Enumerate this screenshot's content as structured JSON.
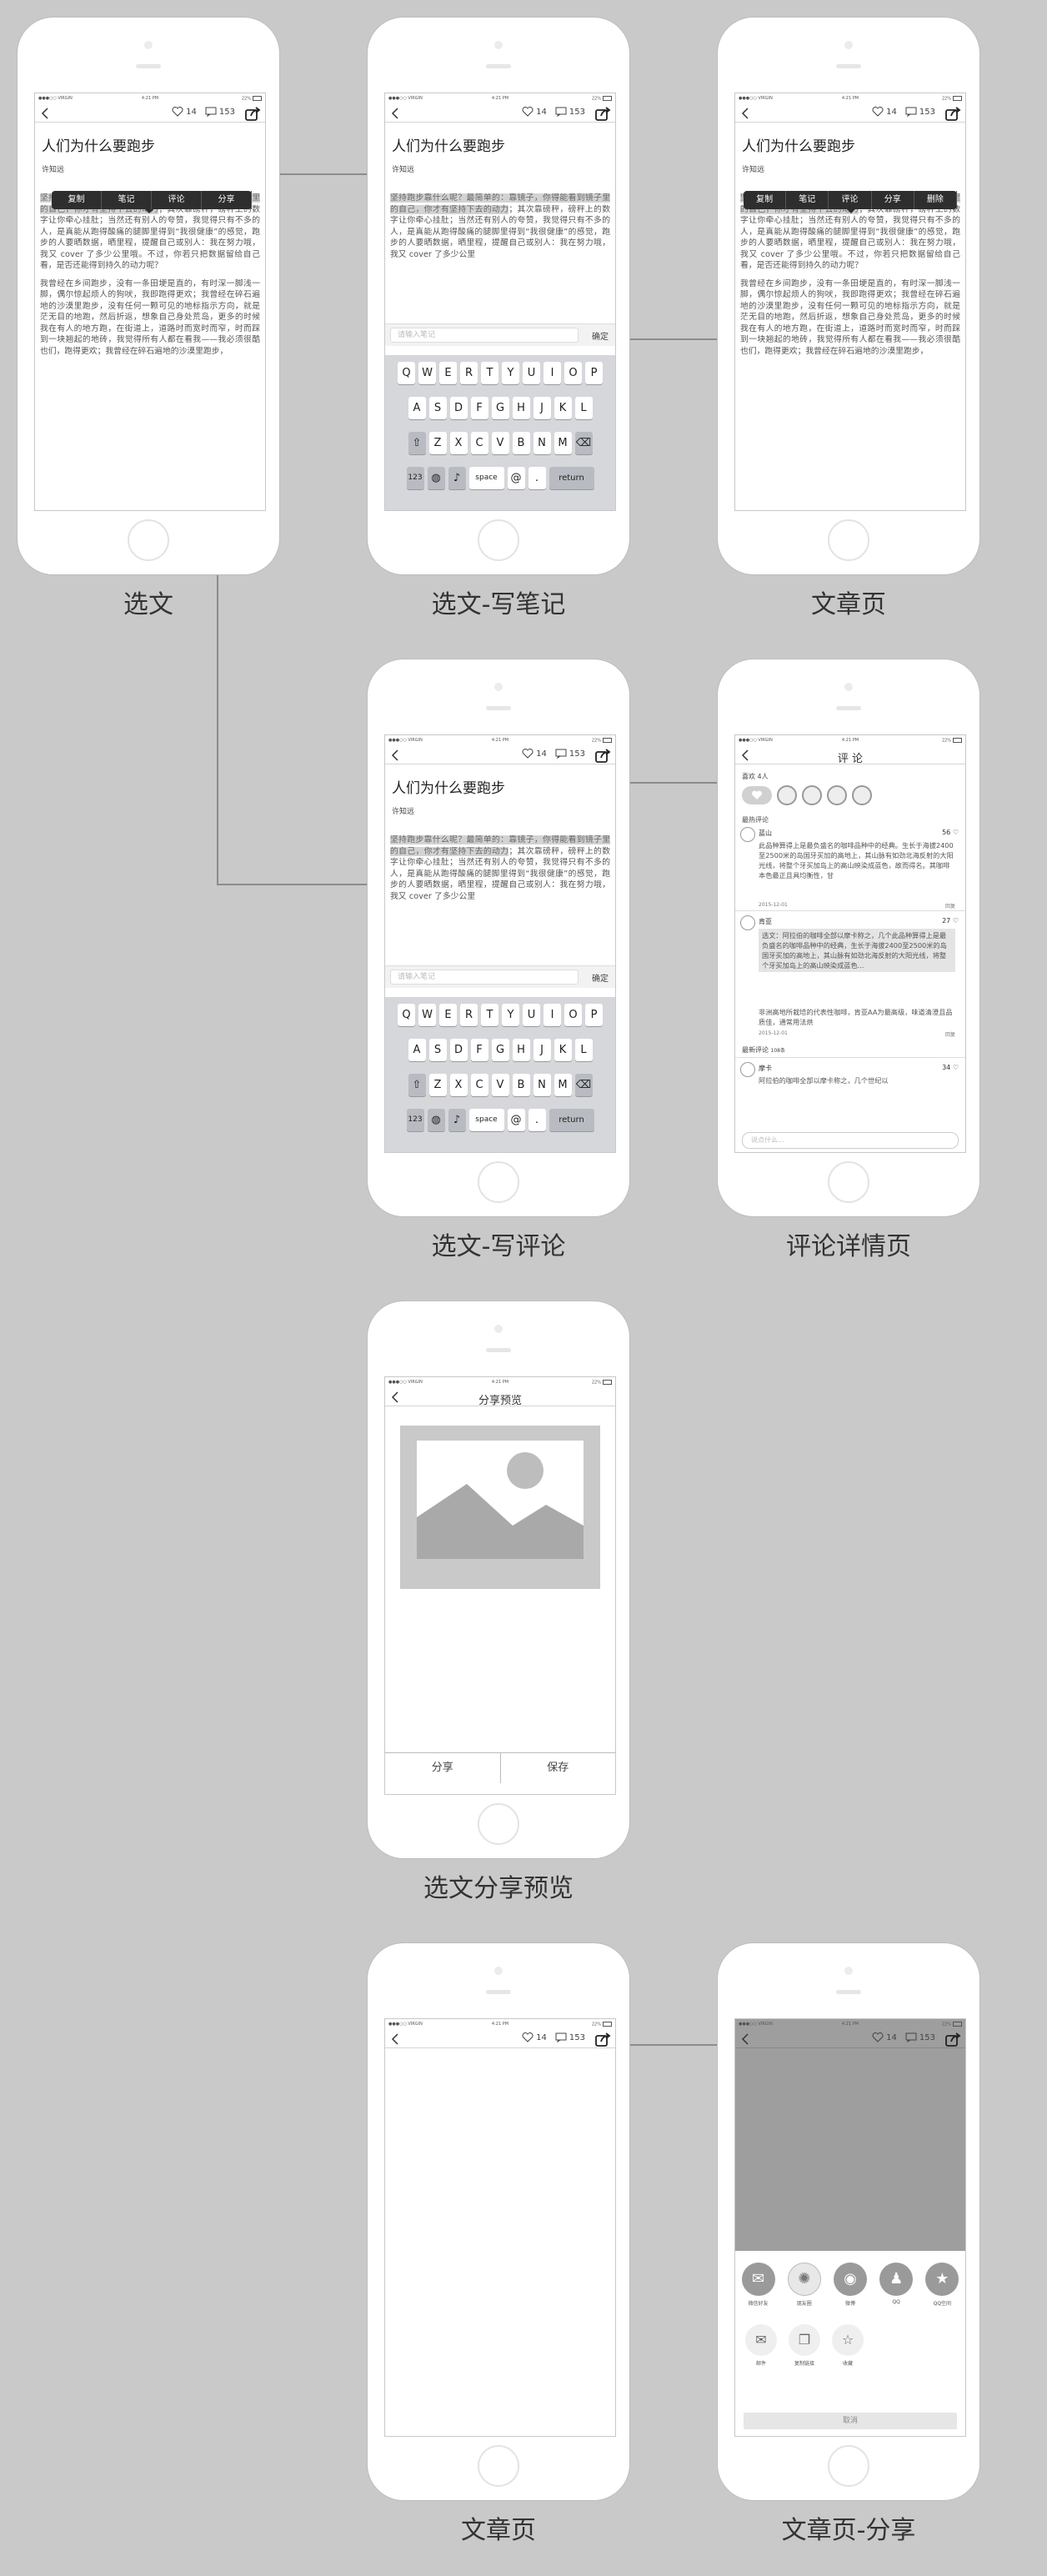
{
  "status": {
    "carrier": "●●●○○ VIRGIN",
    "time": "4:21 PM",
    "battery": "22%"
  },
  "article": {
    "title": "人们为什么要跑步",
    "author": "许知远",
    "likes": "14",
    "comments": "153",
    "hl_text": "坚持跑步靠什么呢？最简单的：靠镜子，你得能看到镜子里的自己，你才有坚持下去的动力",
    "para1": "；其次靠磅秤，磅秤上的数字让你牵心挂肚；当然还有别人的夸赞，我觉得只有不多的人，是真能从跑得酸痛的腿脚里得到“我很健康”的感觉，跑步的人要晒数据，晒里程，提醒自己或别人：我在努力哦，我又 cover 了多少公里哦。不过，你若只把数据留给自己看，是否还能得到持久的动力呢？",
    "para2": "我曾经在乡间跑步，没有一条田埂是直的，有时深一脚浅一脚，偶尔惊起烦人的狗吠，我即跑得更欢；我曾经在碎石遍地的沙漠里跑步，没有任何一颗可见的地标指示方向，就是茫无目的地跑，然后折返，想象自己身处荒岛，更多的时候我在有人的地方跑，在街道上，道路时而宽时而窄，时而踩到一块翘起的地砖，我觉得所有人都在看我——我必须很酷也们，跑得更欢；我曾经在碎石遍地的沙漠里跑步，",
    "para1_short": "；其次靠磅秤，磅秤上的数字让你牵心挂肚；当然还有别人的夸赞，我觉得只有不多的人，是真能从跑得酸痛的腿脚里得到“我很健康”的感觉，跑步的人要晒数据，晒里程，提醒自己或别人：我在努力哦，我又 cover 了多少公里"
  },
  "popup1": [
    "复制",
    "笔记",
    "评论",
    "分享"
  ],
  "popup2": [
    "复制",
    "笔记",
    "评论",
    "分享",
    "删除"
  ],
  "note_placeholder": "请输入笔记",
  "confirm": "确定",
  "keyboard": {
    "row1": [
      "Q",
      "W",
      "E",
      "R",
      "T",
      "Y",
      "U",
      "I",
      "O",
      "P"
    ],
    "row2": [
      "A",
      "S",
      "D",
      "F",
      "G",
      "H",
      "J",
      "K",
      "L"
    ],
    "row3": [
      "Z",
      "X",
      "C",
      "V",
      "B",
      "N",
      "M"
    ],
    "num": "123",
    "space": "space",
    "at": "@",
    "dot": ".",
    "ret": "return"
  },
  "comment_page": {
    "title": "评 论",
    "likes_label": "喜欢",
    "likes_count": "4人",
    "hot_label": "最热评论",
    "c1_name": "蓝山",
    "c1_count": "56",
    "c1_text": "此品种算得上是最负盛名的咖啡品种中的经典。生长于海拔2400至2500米的岛国牙买加的高地上，其山脉有如劲北海反射的大阳光线，将整个牙买加岛上的高山映染成蓝色，故而得名。其咖啡本色最正且具均衡性，甘",
    "c1_date": "2015-12-01",
    "reply": "回复",
    "c2_name": "肯亚",
    "c2_count": "27",
    "c2_quote": "选文：阿拉伯的咖啡全部以摩卡称之，几个此品种算得上是最负盛名的咖啡品种中的经典，生长于海拔2400至2500米的岛国牙买加的高地上，其山脉有如劲北海反射的大阳光线，将整个牙买加岛上的高山映染成蓝色...",
    "c2_text": "非洲高地所栽培的代表性咖啡，肯亚AA为最高级，味道清澄且品质佳，通常用法烘",
    "c2_date": "2015-12-01",
    "new_label": "最新评论",
    "new_count": "108条",
    "c3_name": "摩卡",
    "c3_count": "34",
    "c3_text": "阿拉伯的咖啡全部以摩卡称之，几个世纪以",
    "input_placeholder": "说点什么..."
  },
  "share_preview": {
    "title": "分享预览",
    "share": "分享",
    "save": "保存"
  },
  "share_sheet": {
    "row1": [
      "微信好友",
      "朋友圈",
      "微博",
      "QQ",
      "QQ空间"
    ],
    "row2": [
      "邮件",
      "复制链接",
      "收藏"
    ],
    "cancel": "取消"
  },
  "labels": {
    "l1": "选文",
    "l2": "选文-写笔记",
    "l3": "文章页",
    "l4": "选文-写评论",
    "l5": "评论详情页",
    "l6": "选文分享预览",
    "l7": "文章页",
    "l8": "文章页-分享"
  }
}
